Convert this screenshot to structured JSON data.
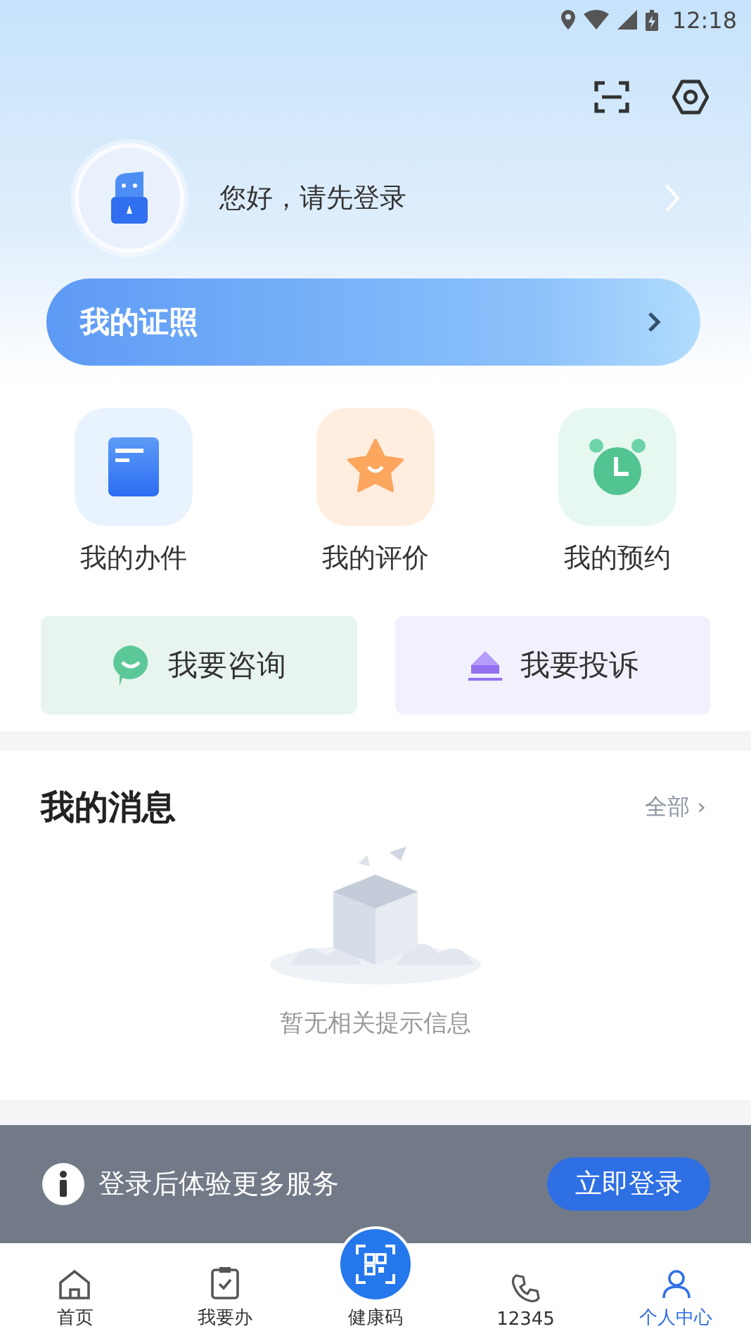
{
  "status_bar": {
    "time": "12:18"
  },
  "profile": {
    "greeting": "您好，请先登录"
  },
  "license_bar": {
    "label": "我的证照"
  },
  "shortcuts": [
    {
      "label": "我的办件",
      "kind": "doc"
    },
    {
      "label": "我的评价",
      "kind": "star"
    },
    {
      "label": "我的预约",
      "kind": "clock"
    }
  ],
  "actions": [
    {
      "label": "我要咨询",
      "kind": "chat"
    },
    {
      "label": "我要投诉",
      "kind": "complain"
    }
  ],
  "messages": {
    "title": "我的消息",
    "more": "全部 ›",
    "empty_text": "暂无相关提示信息"
  },
  "login_banner": {
    "text": "登录后体验更多服务",
    "button": "立即登录"
  },
  "nav": [
    {
      "label": "首页",
      "kind": "home",
      "selected": false
    },
    {
      "label": "我要办",
      "kind": "todo",
      "selected": false
    },
    {
      "label": "健康码",
      "kind": "qr",
      "selected": false
    },
    {
      "label": "12345",
      "kind": "phone",
      "selected": false
    },
    {
      "label": "个人中心",
      "kind": "user",
      "selected": true
    }
  ]
}
